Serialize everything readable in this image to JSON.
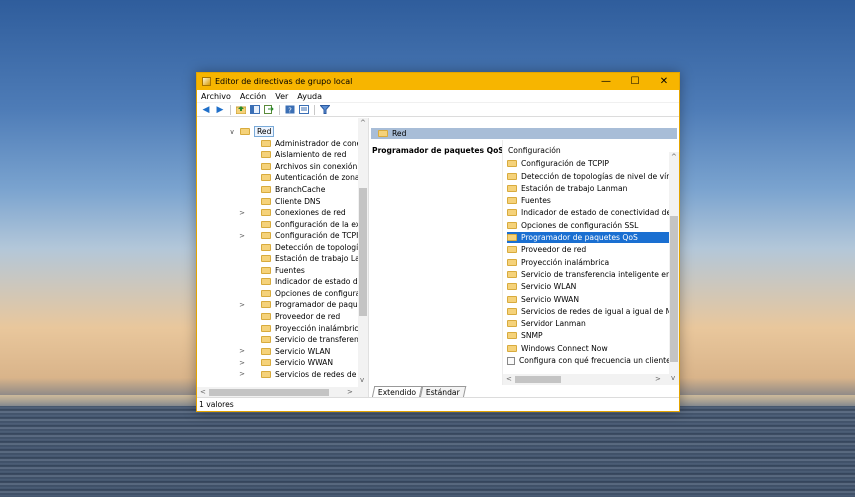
{
  "window": {
    "title": "Editor de directivas de grupo local",
    "accent_color": "#f7b500",
    "controls": {
      "minimize": "—",
      "maximize": "☐",
      "close": "✕"
    }
  },
  "menu": [
    "Archivo",
    "Acción",
    "Ver",
    "Ayuda"
  ],
  "toolbar": {
    "icons": [
      "back-arrow-icon",
      "forward-arrow-icon",
      "up-folder-icon",
      "show-hide-tree-icon",
      "export-list-icon",
      "help-icon",
      "properties-icon",
      "filter-icon"
    ]
  },
  "tree": {
    "root": {
      "label": "Red",
      "expander": "∨"
    },
    "items": [
      {
        "label": "Administrador de conexione",
        "expander": ""
      },
      {
        "label": "Aislamiento de red",
        "expander": ""
      },
      {
        "label": "Archivos sin conexión",
        "expander": ""
      },
      {
        "label": "Autenticación de zona con c",
        "expander": ""
      },
      {
        "label": "BranchCache",
        "expander": ""
      },
      {
        "label": "Cliente DNS",
        "expander": ""
      },
      {
        "label": "Conexiones de red",
        "expander": ">"
      },
      {
        "label": "Configuración de la experiei",
        "expander": ""
      },
      {
        "label": "Configuración de TCPIP",
        "expander": ">"
      },
      {
        "label": "Detección de topologías de",
        "expander": ""
      },
      {
        "label": "Estación de trabajo Lanman",
        "expander": ""
      },
      {
        "label": "Fuentes",
        "expander": ""
      },
      {
        "label": "Indicador de estado de cone",
        "expander": ""
      },
      {
        "label": "Opciones de configuración",
        "expander": ""
      },
      {
        "label": "Programador de paquetes C",
        "expander": ">"
      },
      {
        "label": "Proveedor de red",
        "expander": ""
      },
      {
        "label": "Proyección inalámbrica",
        "expander": ""
      },
      {
        "label": "Servicio de transferencia inte",
        "expander": ""
      },
      {
        "label": "Servicio WLAN",
        "expander": ">"
      },
      {
        "label": "Servicio WWAN",
        "expander": ">"
      },
      {
        "label": "Servicios de redes de igual a",
        "expander": ">"
      }
    ]
  },
  "right_pane": {
    "header": "Red",
    "description_title": "Programador de paquetes QoS",
    "list_header": "Configuración",
    "items": [
      {
        "label": "Configuración de TCPIP",
        "type": "folder"
      },
      {
        "label": "Detección de topologías de nivel de vínculo",
        "type": "folder"
      },
      {
        "label": "Estación de trabajo Lanman",
        "type": "folder"
      },
      {
        "label": "Fuentes",
        "type": "folder"
      },
      {
        "label": "Indicador de estado de conectividad de red",
        "type": "folder"
      },
      {
        "label": "Opciones de configuración SSL",
        "type": "folder"
      },
      {
        "label": "Programador de paquetes QoS",
        "type": "folder",
        "selected": true
      },
      {
        "label": "Proveedor de red",
        "type": "folder"
      },
      {
        "label": "Proyección inalámbrica",
        "type": "folder"
      },
      {
        "label": "Servicio de transferencia inteligente en segundo plano",
        "type": "folder"
      },
      {
        "label": "Servicio WLAN",
        "type": "folder"
      },
      {
        "label": "Servicio WWAN",
        "type": "folder"
      },
      {
        "label": "Servicios de redes de igual a igual de Microsoft",
        "type": "folder"
      },
      {
        "label": "Servidor Lanman",
        "type": "folder"
      },
      {
        "label": "SNMP",
        "type": "folder"
      },
      {
        "label": "Windows Connect Now",
        "type": "folder"
      },
      {
        "label": "Configura con qué frecuencia un cliente DFS",
        "type": "policy"
      }
    ],
    "selection_color": "#1a6fd1"
  },
  "tabs": [
    "Extendido",
    "Estándar"
  ],
  "status": "1 valores"
}
